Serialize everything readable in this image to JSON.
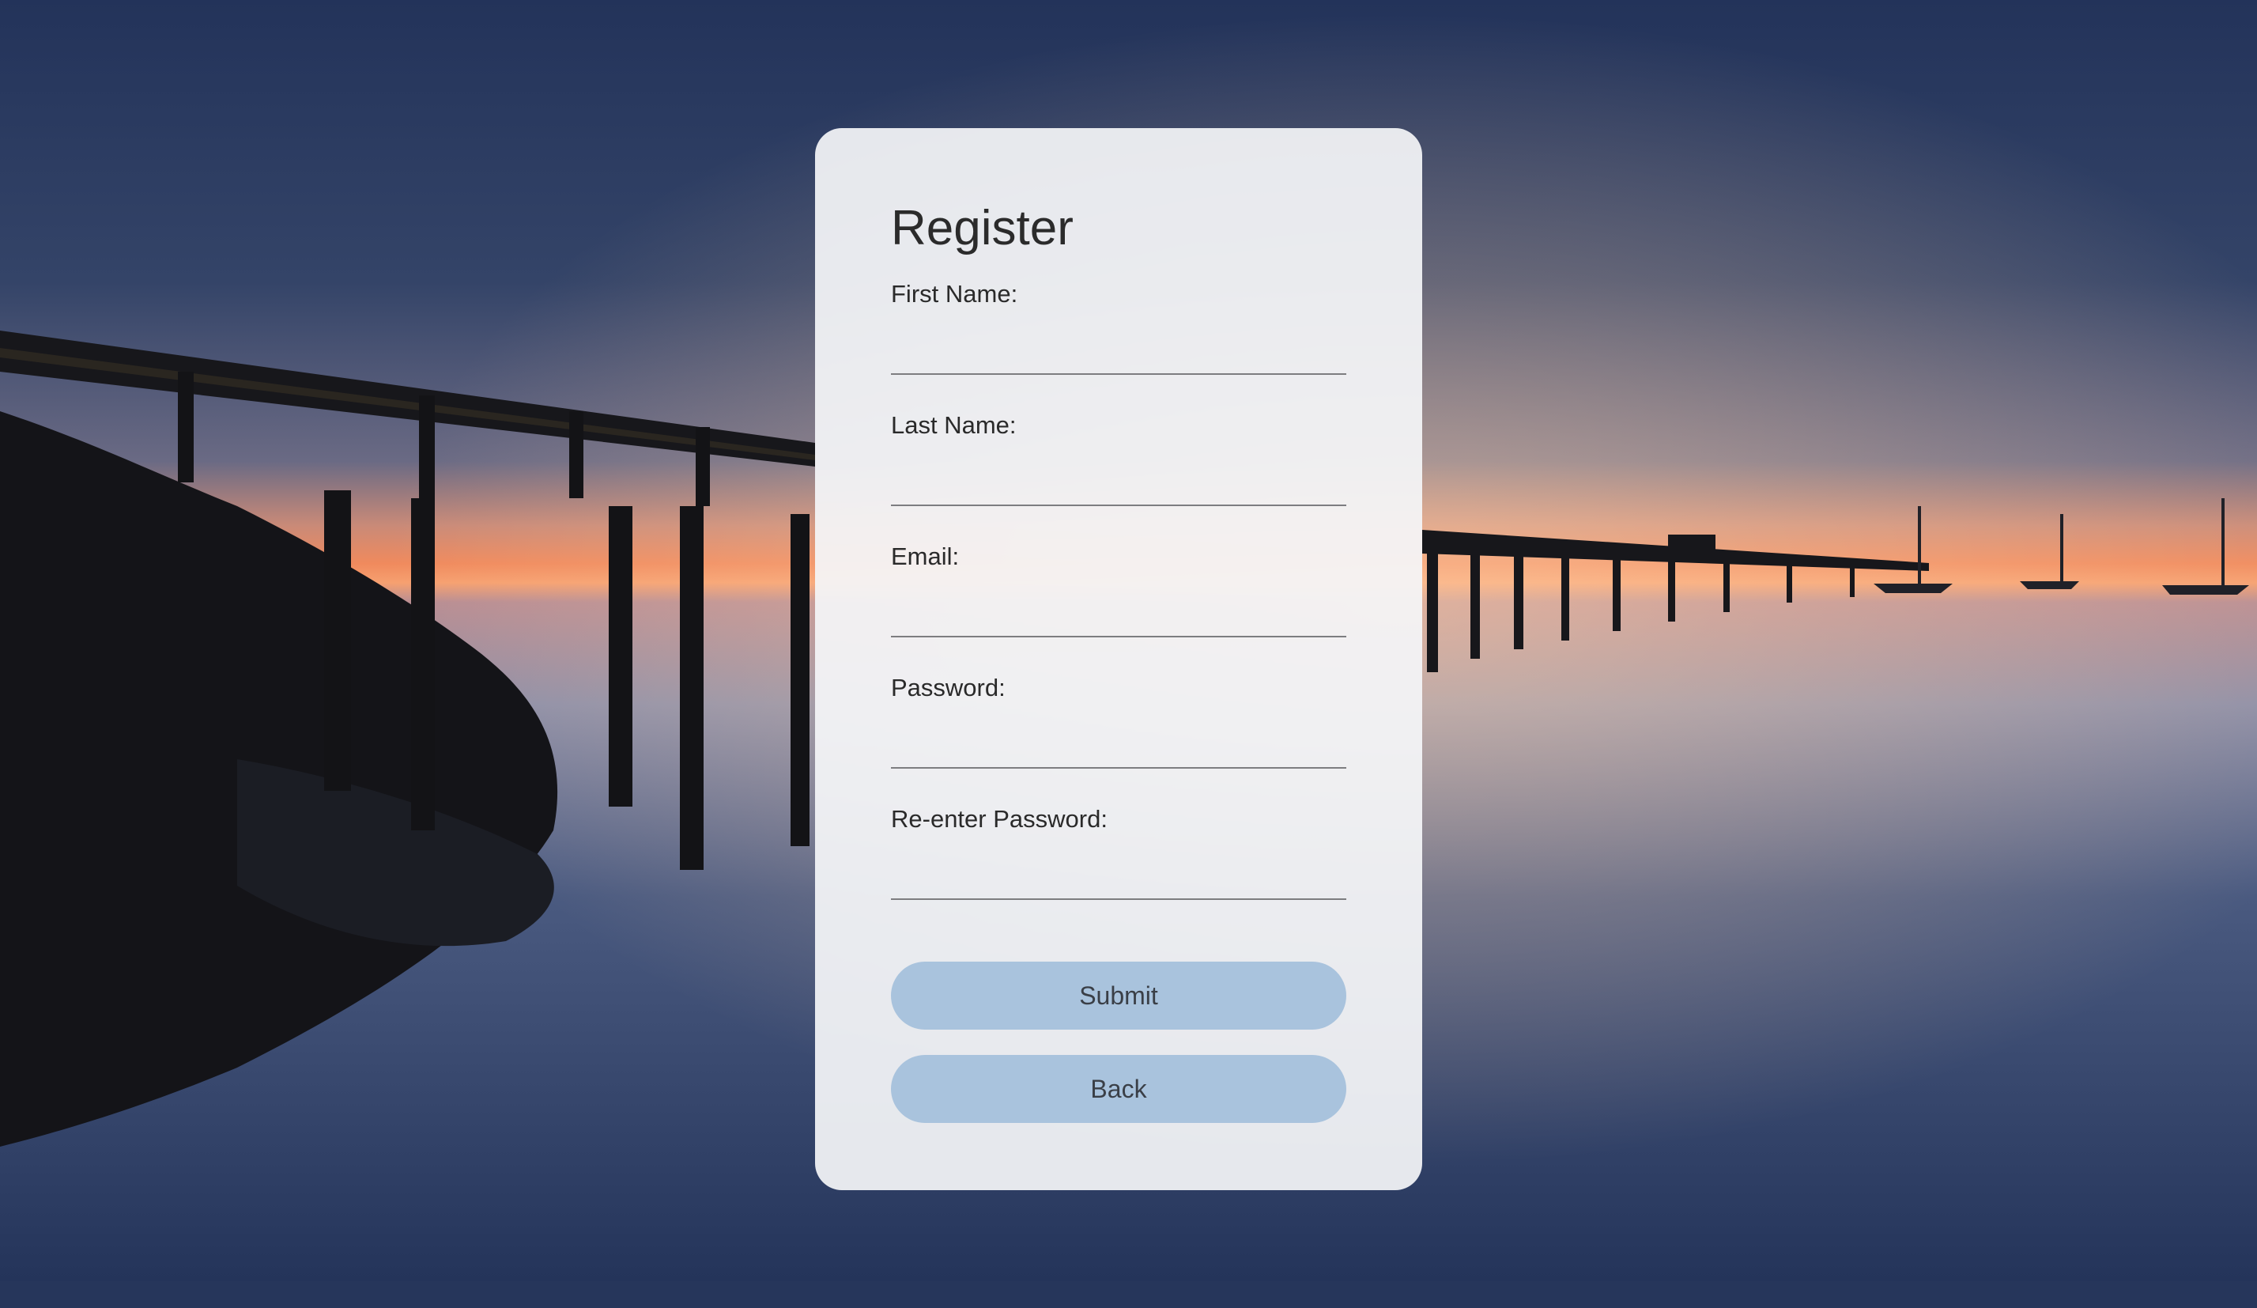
{
  "form": {
    "title": "Register",
    "fields": [
      {
        "label": "First Name:",
        "value": ""
      },
      {
        "label": "Last Name:",
        "value": ""
      },
      {
        "label": "Email:",
        "value": ""
      },
      {
        "label": "Password:",
        "value": ""
      },
      {
        "label": "Re-enter Password:",
        "value": ""
      }
    ],
    "submit_label": "Submit",
    "back_label": "Back"
  },
  "colors": {
    "button_bg": "#a9c3dd",
    "card_bg": "#f4f5f8",
    "background_sky": "#26355a",
    "sunset_accent": "#f08a5d"
  }
}
